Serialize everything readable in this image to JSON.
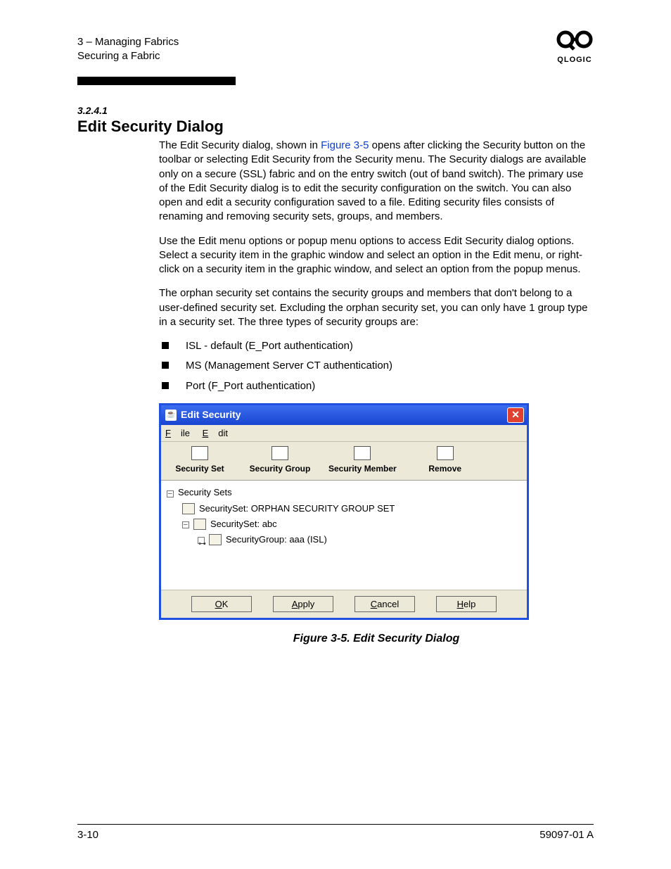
{
  "header": {
    "chapter_line": "3 – Managing Fabrics",
    "section_line": "Securing a Fabric",
    "brand": "QLOGIC"
  },
  "section": {
    "number": "3.2.4.1",
    "title": "Edit Security Dialog"
  },
  "paragraphs": {
    "p1a": "The Edit Security dialog, shown in ",
    "p1_link": "Figure 3-5",
    "p1b": " opens after clicking the Security button on the toolbar or selecting Edit Security from the Security menu. The Security dialogs are available only on a secure (SSL) fabric and on the entry switch (out of band switch). The primary use of the Edit Security dialog is to edit the security configuration on the switch. You can also open and edit a security configuration saved to a file. Editing security files consists of renaming and removing security sets, groups, and members.",
    "p2": "Use the Edit menu options or popup menu options to access Edit Security dialog options. Select a security item in the graphic window and select an option in the Edit menu, or right-click on a security item in the graphic window, and select an option from the popup menus.",
    "p3": "The orphan security set contains the security groups and members that don't belong to a user-defined security set. Excluding the orphan security set, you can only have 1 group type in a security set. The three types of security groups are:"
  },
  "bullets": [
    "ISL - default (E_Port authentication)",
    "MS (Management Server CT authentication)",
    "Port (F_Port authentication)"
  ],
  "dialog": {
    "title": "Edit Security",
    "menu": {
      "file": "File",
      "edit": "Edit"
    },
    "toolbar": {
      "set": "Security Set",
      "group": "Security Group",
      "member": "Security Member",
      "remove": "Remove"
    },
    "tree": {
      "root": "Security Sets",
      "n1": "SecuritySet: ORPHAN SECURITY GROUP SET",
      "n2": "SecuritySet: abc",
      "n3": "SecurityGroup: aaa (ISL)"
    },
    "buttons": {
      "ok": "OK",
      "apply": "Apply",
      "cancel": "Cancel",
      "help": "Help"
    }
  },
  "caption": "Figure 3-5.  Edit Security Dialog",
  "footer": {
    "left": "3-10",
    "right": "59097-01 A"
  }
}
